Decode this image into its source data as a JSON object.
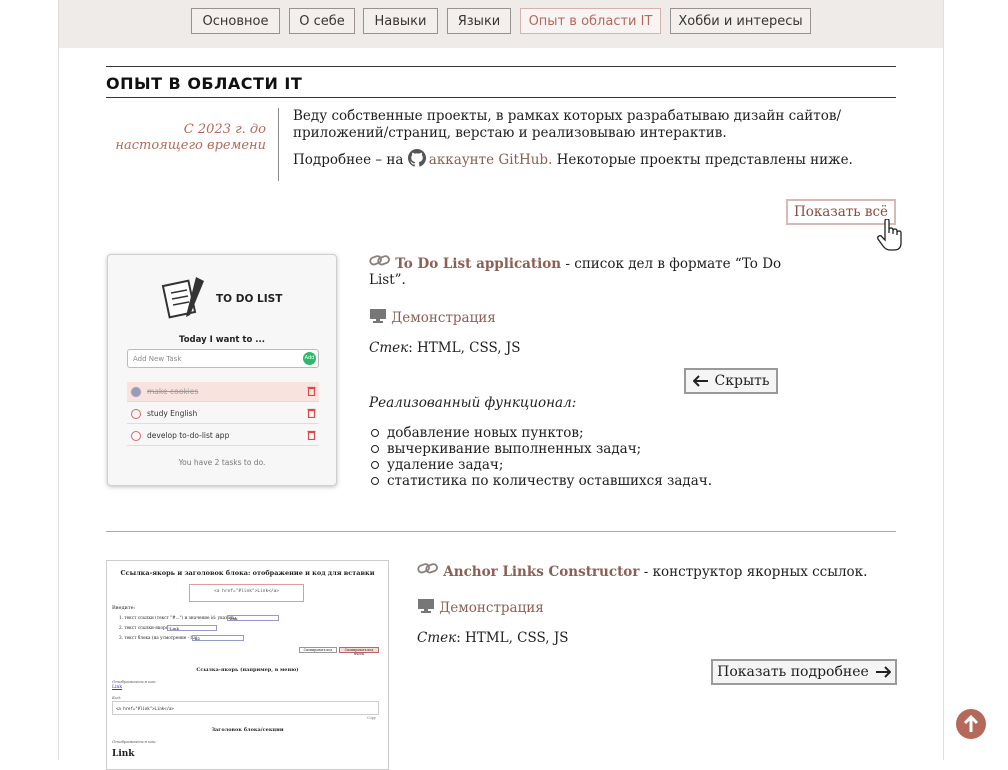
{
  "nav": {
    "items": [
      "Основное",
      "О себе",
      "Навыки",
      "Языки",
      "Опыт в области IT",
      "Хобби и интересы"
    ],
    "active": "Опыт в области IT"
  },
  "section": {
    "title": "ОПЫТ В ОБЛАСТИ IT",
    "date_line1": "С 2023 г. до",
    "date_line2": "настоящего времени",
    "desc_p1": "Веду собственные проекты, в рамках которых разрабатываю дизайн сайтов/ приложений/страниц, верстаю и реализовываю интерактив.",
    "desc_p2_before": "Подробнее – на ",
    "github_link": "аккаунте GitHub.",
    "desc_p2_after": " Некоторые проекты представлены ниже.",
    "show_all": "Показать всё"
  },
  "project1": {
    "title": "To Do List application",
    "description": " - список дел в формате “To Do List”.",
    "demo": "Демонстрация",
    "stack_label": "Стек",
    "stack": ": HTML, CSS, JS",
    "hide_button": "Скрыть",
    "features_title": "Реализованный функционал:",
    "features": [
      "добавление новых пунктов;",
      "вычеркивание выполненных задач;",
      "удаление задач;",
      "статистика по количеству оставшихся задач."
    ],
    "preview": {
      "title": "TO DO LIST",
      "prompt": "Today I want to ...",
      "placeholder": "Add New Task",
      "add": "Add",
      "tasks": [
        "make cookies",
        "study English",
        "develop to-do-list app"
      ],
      "count_text": "You have 2 tasks to do."
    }
  },
  "project2": {
    "title": "Anchor Links Constructor",
    "description": " - конструктор якорных ссылок.",
    "demo": "Демонстрация",
    "stack_label": "Стек",
    "stack": ": HTML, CSS, JS",
    "more_button": "Показать подробнее",
    "preview": {
      "heading": "Ссылка-якорь и заголовок блока: отображение и код для вставки",
      "code": "<a href=\"#link\">Link</a>",
      "input_label": "Введите:",
      "item1": "1. текст ссылки (текст \"#...\") и значение id: указать:",
      "item2": "2. текст ссылки-якоря:",
      "item3": "3. текст блока (на усмотрение - h2):",
      "value1": "link",
      "value2": "Link",
      "value3": "h2",
      "btn_copy": "Скопировать код",
      "btn_copy2": "Скопировать код ячеек",
      "sub1": "Ссылка-якорь (например, в меню)",
      "shown_as": "Отображается как:",
      "link_text": "Link",
      "code_label": "Код:",
      "code2": "<a href=\"#link\">Link</a>",
      "copy": "Copy",
      "sub2": "Заголовок блока/секции",
      "shown_as2": "Отображается как:",
      "big_link": "Link"
    }
  }
}
